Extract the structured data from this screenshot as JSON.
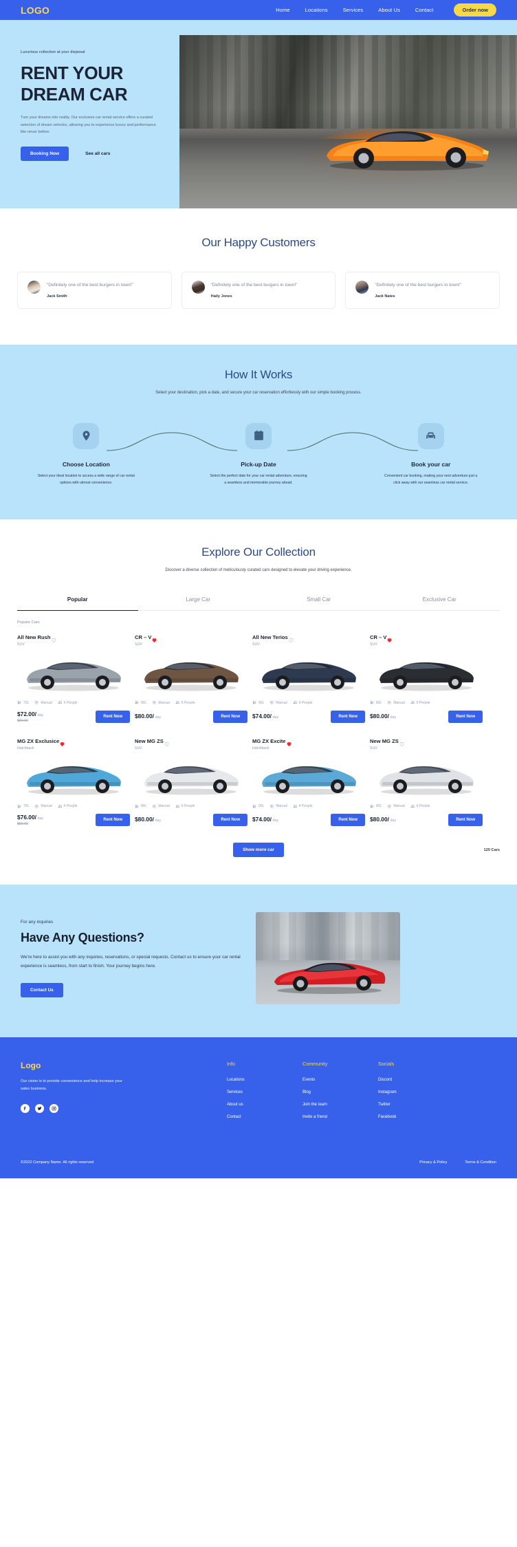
{
  "header": {
    "logo": "LOGO",
    "nav": [
      {
        "label": "Home"
      },
      {
        "label": "Locations"
      },
      {
        "label": "Services"
      },
      {
        "label": "About Us"
      },
      {
        "label": "Contact"
      }
    ],
    "cta": "Order now",
    "brand_color": "#3761ea",
    "accent_color": "#f7d948"
  },
  "hero": {
    "eyebrow": "Luxurious collection at your disposal",
    "title_line1": "RENT YOUR",
    "title_line2": "DREAM CAR",
    "description": "Turn your dreams into reality. Our exclusive car rental service offers a curated selection of dream vehicles, allowing you to experience luxury and performance like never before.",
    "primary_button": "Booking Now",
    "secondary_button": "See all cars",
    "background_color": "#b9e2fb"
  },
  "testimonials": {
    "title": "Our Happy Customers",
    "items": [
      {
        "quote": "“Definitely one of the best burgers in town!”",
        "name": "Jack Smith"
      },
      {
        "quote": "“Definitely one of the best burgers in town!”",
        "name": "Haily Jones"
      },
      {
        "quote": "“Definitely one of the best burgers in town!”",
        "name": "Jack Nates"
      }
    ]
  },
  "how_it_works": {
    "title": "How It Works",
    "subtitle": "Select your destination, pick a date, and secure your car reservation effortlessly with our simple booking process.",
    "steps": [
      {
        "icon": "location-pin-icon",
        "title": "Choose Location",
        "description": "Select your ideal location to access a wide range of car rental options with utmost convenience."
      },
      {
        "icon": "calendar-icon",
        "title": "Pick-up Date",
        "description": "Select the perfect date for your car rental adventure, ensuring a seamless and memorable journey ahead."
      },
      {
        "icon": "car-icon",
        "title": "Book your car",
        "description": "Convenient car booking, making your next adventure just a click away with our seamless car rental service."
      }
    ]
  },
  "collection": {
    "title": "Explore Our Collection",
    "subtitle": "Discover a diverse collection of meticulously curated cars designed to elevate your driving experience.",
    "tabs": [
      {
        "label": "Popular",
        "active": true
      },
      {
        "label": "Large Car",
        "active": false
      },
      {
        "label": "Small Car",
        "active": false
      },
      {
        "label": "Exclusive Car",
        "active": false
      }
    ],
    "group_label": "Popular Cars",
    "show_more": "Show more car",
    "count": "120 Cars",
    "cars": [
      {
        "name": "All New Rush",
        "type": "SUV",
        "favorite": false,
        "fuel": "70L",
        "transmission": "Manual",
        "capacity": "6 People",
        "price": "$72.00/",
        "per": "day",
        "old_price": "$80.00",
        "button": "Rent Now",
        "color": "#9aa2ac"
      },
      {
        "name": "CR – V",
        "type": "SUV",
        "favorite": true,
        "fuel": "80L",
        "transmission": "Manual",
        "capacity": "6 People",
        "price": "$80.00/",
        "per": "day",
        "old_price": "",
        "button": "Rent Now",
        "color": "#6f5642"
      },
      {
        "name": "All New Terios",
        "type": "SUV",
        "favorite": false,
        "fuel": "90L",
        "transmission": "Manual",
        "capacity": "6 People",
        "price": "$74.00/",
        "per": "day",
        "old_price": "",
        "button": "Rent Now",
        "color": "#2e3a50"
      },
      {
        "name": "CR – V",
        "type": "SUV",
        "favorite": true,
        "fuel": "80L",
        "transmission": "Manual",
        "capacity": "6 People",
        "price": "$80.00/",
        "per": "day",
        "old_price": "",
        "button": "Rent Now",
        "color": "#2a2d32"
      },
      {
        "name": "MG ZX Exclusice",
        "type": "Hatchback",
        "favorite": true,
        "fuel": "70L",
        "transmission": "Manual",
        "capacity": "4 People",
        "price": "$76.00/",
        "per": "day",
        "old_price": "$80.00",
        "button": "Rent Now",
        "color": "#4fa8d8"
      },
      {
        "name": "New MG ZS",
        "type": "SUV",
        "favorite": false,
        "fuel": "80L",
        "transmission": "Manual",
        "capacity": "6 People",
        "price": "$80.00/",
        "per": "day",
        "old_price": "",
        "button": "Rent Now",
        "color": "#e6e9ec"
      },
      {
        "name": "MG ZX Excite",
        "type": "Hatchback",
        "favorite": true,
        "fuel": "90L",
        "transmission": "Manual",
        "capacity": "4 People",
        "price": "$74.00/",
        "per": "day",
        "old_price": "",
        "button": "Rent Now",
        "color": "#5aa9d6"
      },
      {
        "name": "New MG ZS",
        "type": "SUV",
        "favorite": false,
        "fuel": "80L",
        "transmission": "Manual",
        "capacity": "6 People",
        "price": "$80.00/",
        "per": "day",
        "old_price": "",
        "button": "Rent Now",
        "color": "#dfe3e7"
      }
    ]
  },
  "questions": {
    "eyebrow": "For any inquiries",
    "title": "Have Any Questions?",
    "description": "We're here to assist you with any inquiries, reservations, or special requests. Contact us to ensure your car rental experience is seamless, from start to finish. Your journey begins here.",
    "button": "Contact Us"
  },
  "footer": {
    "logo": "Logo",
    "vision": "Our vision is to provide convenience and help increase your sales business.",
    "socials": [
      {
        "name": "facebook-icon"
      },
      {
        "name": "twitter-icon"
      },
      {
        "name": "instagram-icon"
      }
    ],
    "columns": [
      {
        "title": "Info",
        "links": [
          "Locations",
          "Services",
          "About us",
          "Contact"
        ]
      },
      {
        "title": "Community",
        "links": [
          "Events",
          "Blog",
          "Join the team",
          "Invite a friend"
        ]
      },
      {
        "title": "Socials",
        "links": [
          "Discord",
          "Instagram",
          "Twitter",
          "Facebook"
        ]
      }
    ],
    "copyright": "©2022 Company Name. All rights reserved",
    "legal": [
      "Privacy & Policy",
      "Terms & Condition"
    ]
  }
}
